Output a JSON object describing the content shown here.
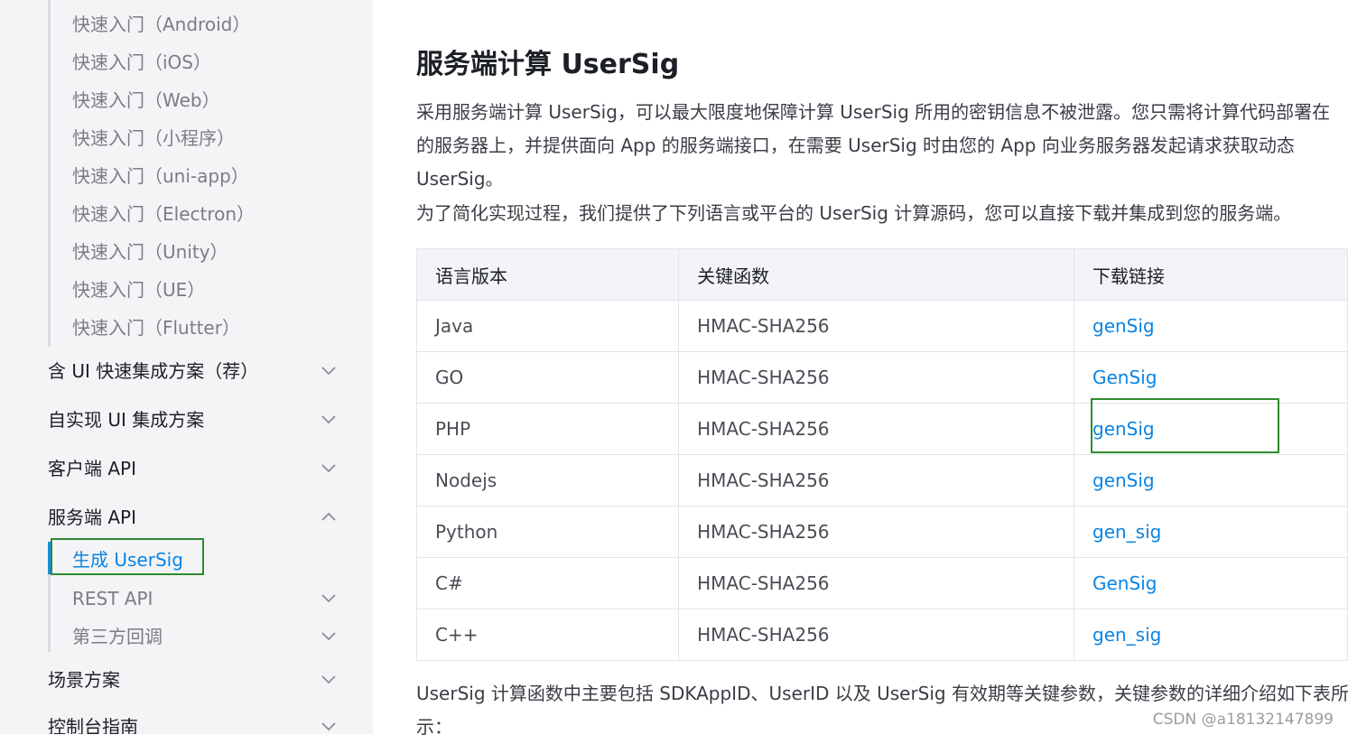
{
  "sidebar": {
    "quickstart_items": [
      "快速入门（Android）",
      "快速入门（iOS）",
      "快速入门（Web）",
      "快速入门（小程序）",
      "快速入门（uni-app）",
      "快速入门（Electron）",
      "快速入门（Unity）",
      "快速入门（UE）",
      "快速入门（Flutter）"
    ],
    "sections": [
      {
        "label": "含 UI 快速集成方案（荐）",
        "expanded": false
      },
      {
        "label": "自实现 UI 集成方案",
        "expanded": false
      },
      {
        "label": "客户端 API",
        "expanded": false
      },
      {
        "label": "服务端 API",
        "expanded": true
      }
    ],
    "server_api_items": {
      "active": "生成 UserSig",
      "rest": "REST API",
      "callback": "第三方回调"
    },
    "more_sections": [
      {
        "label": "场景方案",
        "expanded": false
      },
      {
        "label": "控制台指南",
        "expanded": false
      }
    ],
    "colors": {
      "active": "#0a84e3",
      "highlight": "#2e8b2e"
    }
  },
  "main": {
    "title": "服务端计算 UserSig",
    "intro_lines": [
      "采用服务端计算 UserSig，可以最大限度地保障计算 UserSig 所用的密钥信息不被泄露。您只需将计算代码部署在",
      "的服务器上，并提供面向 App 的服务端接口，在需要 UserSig 时由您的 App 向业务服务器发起请求获取动态",
      "UserSig。",
      "为了简化实现过程，我们提供了下列语言或平台的 UserSig 计算源码，您可以直接下载并集成到您的服务端。"
    ],
    "table": {
      "headers": [
        "语言版本",
        "关键函数",
        "下载链接"
      ],
      "rows": [
        [
          "Java",
          "HMAC-SHA256",
          "genSig"
        ],
        [
          "GO",
          "HMAC-SHA256",
          "GenSig"
        ],
        [
          "PHP",
          "HMAC-SHA256",
          "genSig"
        ],
        [
          "Nodejs",
          "HMAC-SHA256",
          "genSig"
        ],
        [
          "Python",
          "HMAC-SHA256",
          "gen_sig"
        ],
        [
          "C#",
          "HMAC-SHA256",
          "GenSig"
        ],
        [
          "C++",
          "HMAC-SHA256",
          "gen_sig"
        ]
      ]
    },
    "outro_lines": [
      "UserSig 计算函数中主要包括 SDKAppID、UserID 以及 UserSig 有效期等关键参数，关键参数的详细介绍如下表所",
      "示："
    ]
  },
  "watermark": "CSDN @a18132147899"
}
